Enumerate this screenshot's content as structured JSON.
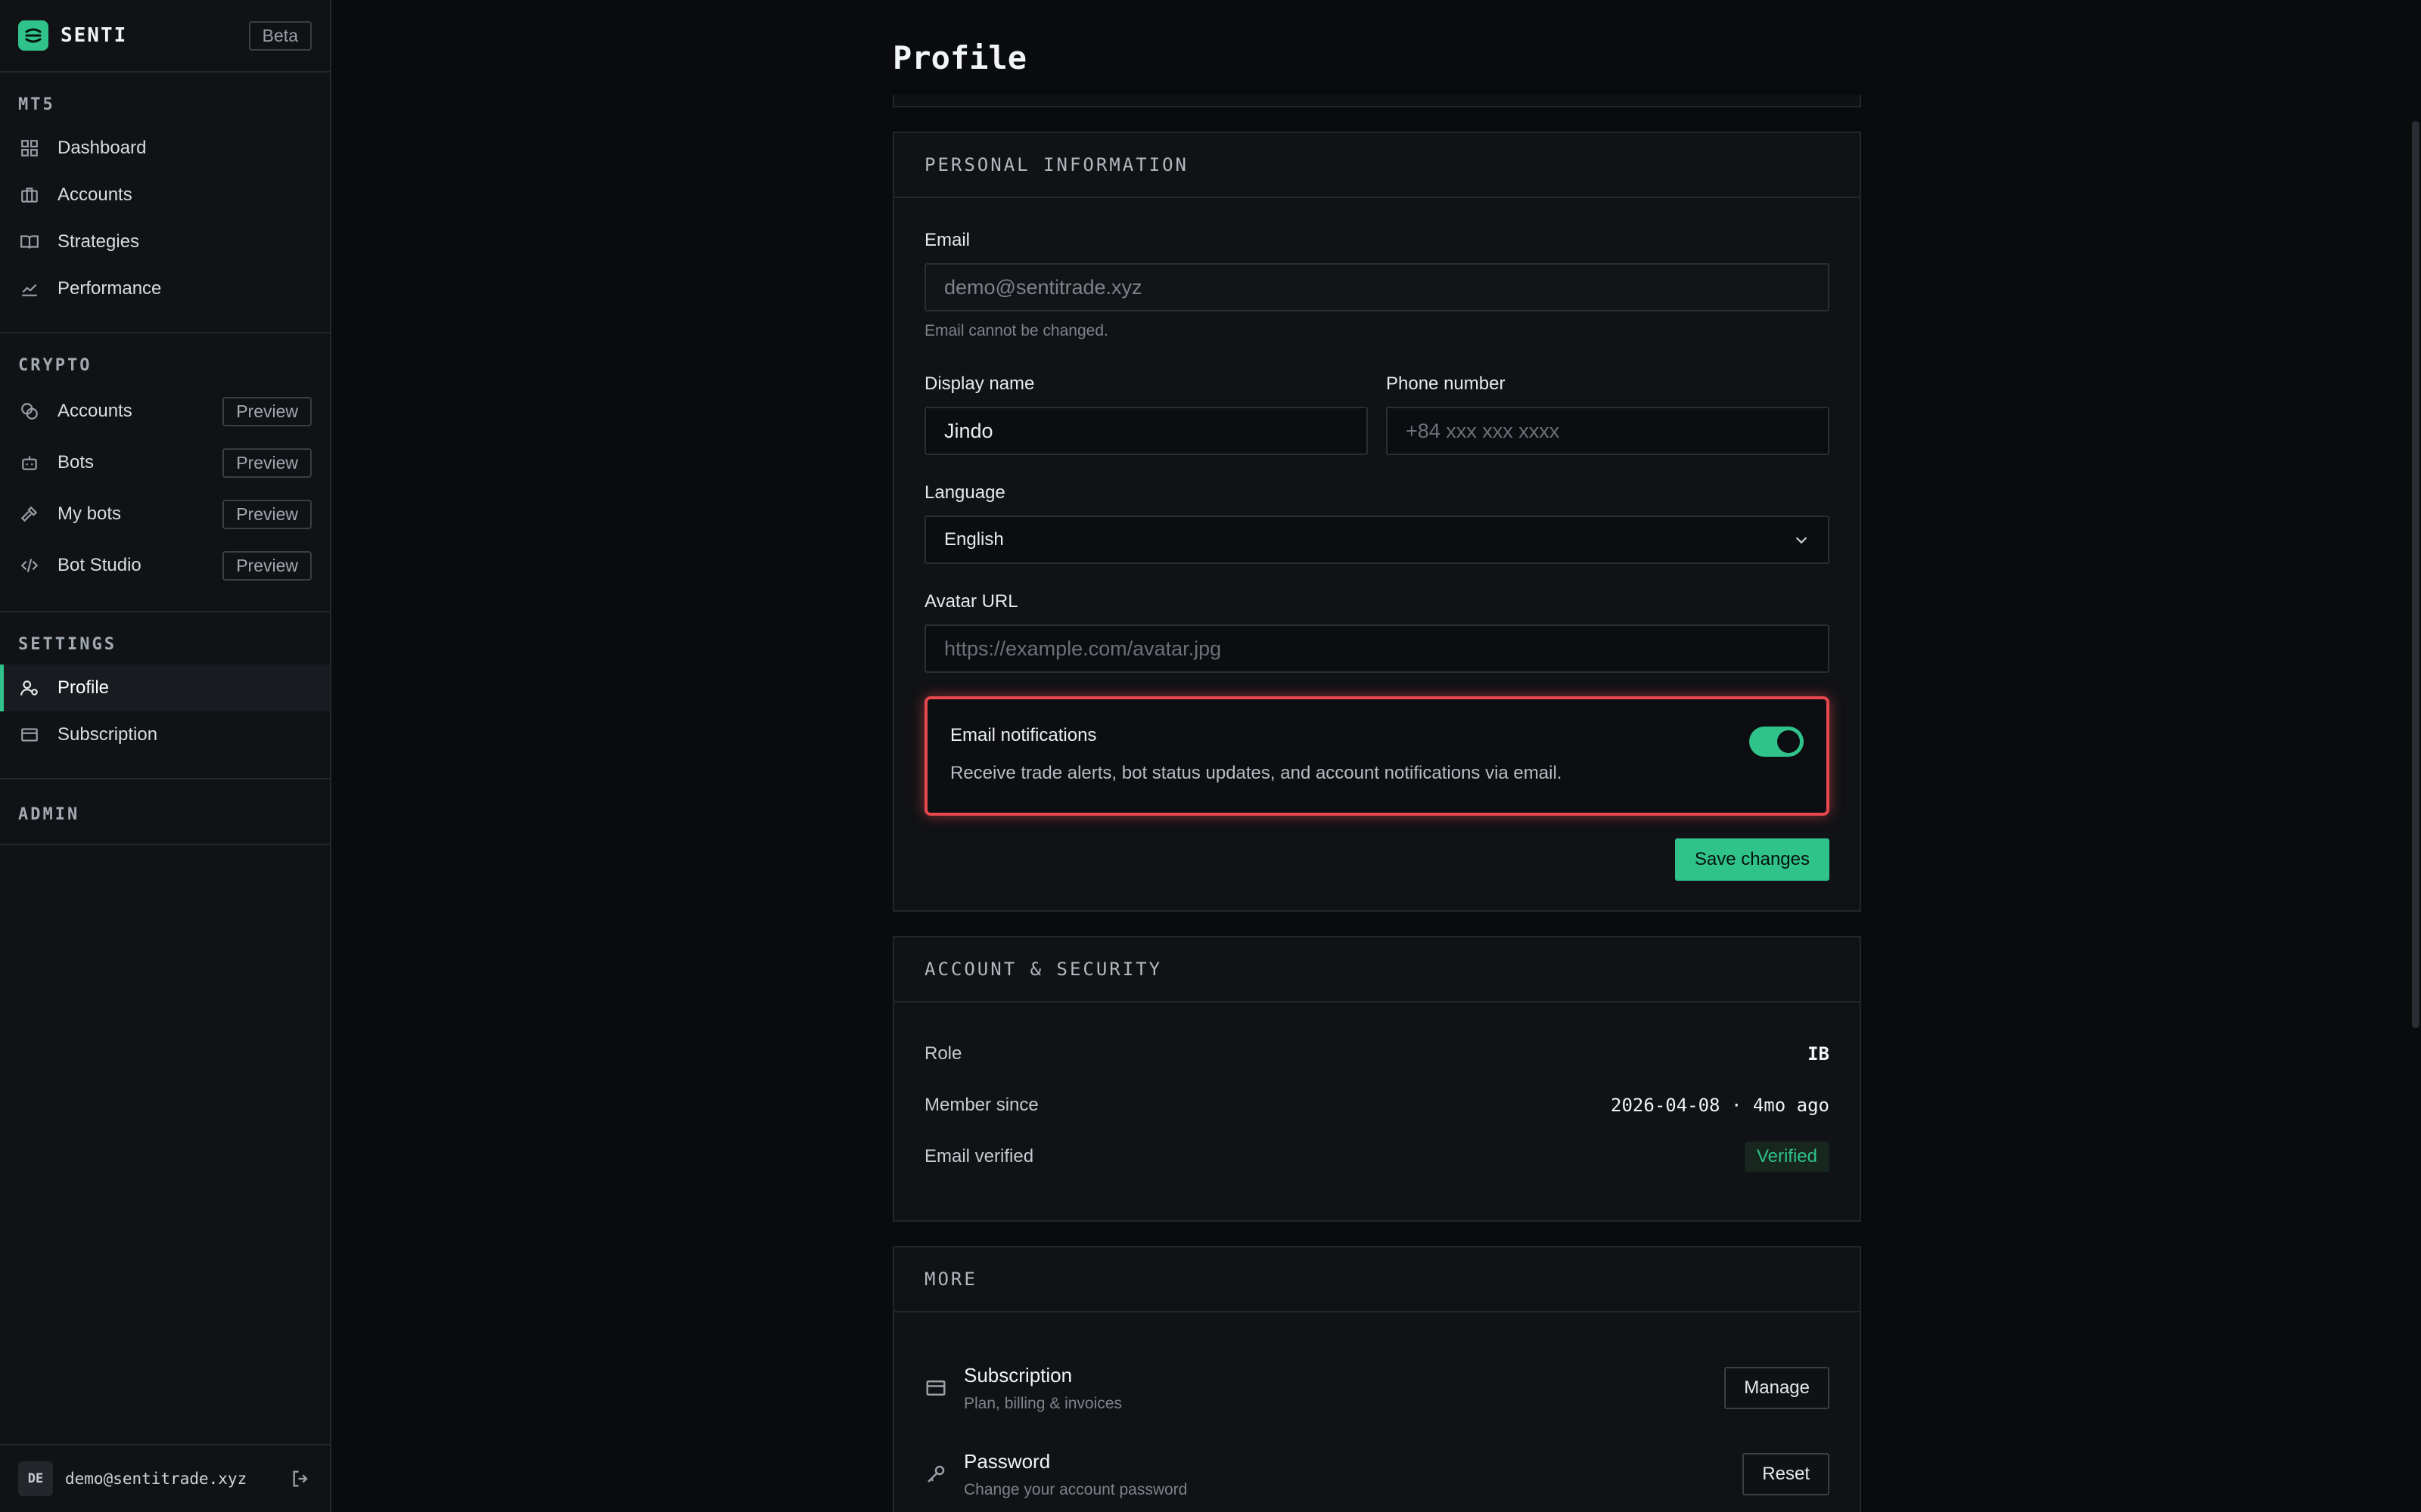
{
  "brand": {
    "name": "SENTI",
    "badge": "Beta"
  },
  "sidebar": {
    "sections": {
      "mt5": {
        "label": "MT5",
        "items": [
          "Dashboard",
          "Accounts",
          "Strategies",
          "Performance"
        ]
      },
      "crypto": {
        "label": "CRYPTO",
        "items": [
          "Accounts",
          "Bots",
          "My bots",
          "Bot Studio"
        ],
        "badge": "Preview"
      },
      "settings": {
        "label": "SETTINGS",
        "items": [
          "Profile",
          "Subscription"
        ]
      },
      "admin": {
        "label": "ADMIN"
      }
    },
    "user": {
      "initials": "DE",
      "email": "demo@sentitrade.xyz"
    }
  },
  "page": {
    "title": "Profile"
  },
  "personal": {
    "heading": "PERSONAL INFORMATION",
    "email_label": "Email",
    "email_value": "demo@sentitrade.xyz",
    "email_hint": "Email cannot be changed.",
    "display_label": "Display name",
    "display_value": "Jindo",
    "phone_label": "Phone number",
    "phone_placeholder": "+84 xxx xxx xxxx",
    "language_label": "Language",
    "language_value": "English",
    "avatar_label": "Avatar URL",
    "avatar_placeholder": "https://example.com/avatar.jpg",
    "notif_title": "Email notifications",
    "notif_desc": "Receive trade alerts, bot status updates, and account notifications via email.",
    "notif_enabled": true,
    "save_label": "Save changes"
  },
  "security": {
    "heading": "ACCOUNT & SECURITY",
    "role_label": "Role",
    "role_value": "IB",
    "since_label": "Member since",
    "since_value": "2026-04-08 · 4mo ago",
    "verified_label": "Email verified",
    "verified_value": "Verified"
  },
  "more": {
    "heading": "MORE",
    "subscription_title": "Subscription",
    "subscription_sub": "Plan, billing & invoices",
    "subscription_btn": "Manage",
    "password_title": "Password",
    "password_sub": "Change your account password",
    "password_btn": "Reset"
  },
  "colors": {
    "accent": "#2fc28a",
    "highlight": "#e5484d",
    "background": "#0a0b0d"
  }
}
